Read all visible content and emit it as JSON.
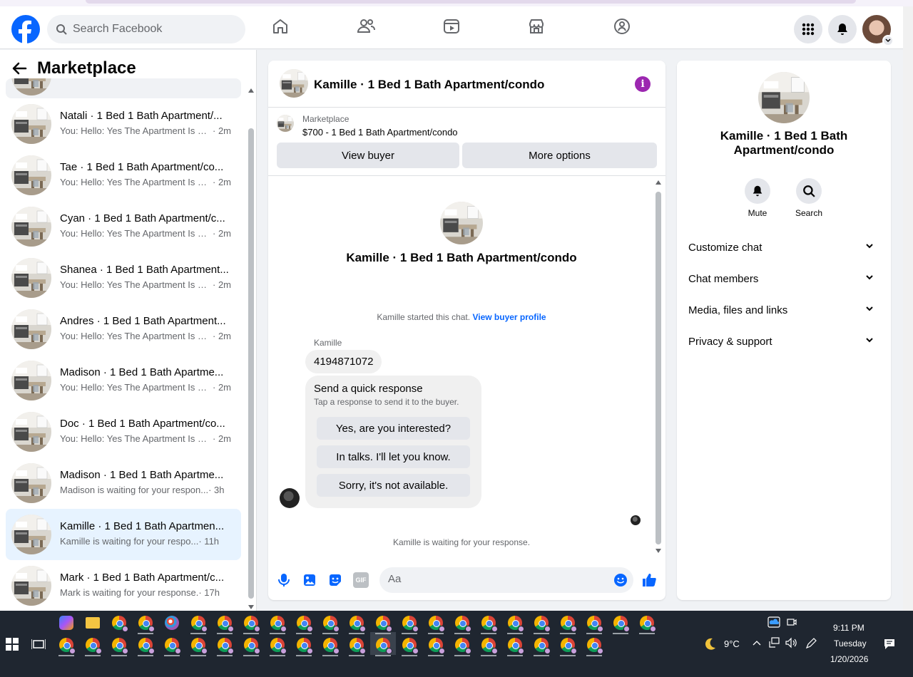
{
  "topnav": {
    "search_placeholder": "Search Facebook"
  },
  "left": {
    "back_label": "←",
    "title": "Marketplace",
    "conversations": [
      {
        "name": "Natali · 1 Bed 1 Bath Apartment/...",
        "preview": "You: Hello: Yes The Apartment Is St...",
        "time": " · 2m"
      },
      {
        "name": "Tae · 1 Bed 1 Bath Apartment/co...",
        "preview": "You: Hello: Yes The Apartment Is St...",
        "time": " · 2m"
      },
      {
        "name": "Cyan · 1 Bed 1 Bath Apartment/c...",
        "preview": "You: Hello: Yes The Apartment Is St...",
        "time": " · 2m"
      },
      {
        "name": "Shanea · 1 Bed 1 Bath Apartment...",
        "preview": "You: Hello: Yes The Apartment Is St...",
        "time": " · 2m"
      },
      {
        "name": "Andres · 1 Bed 1 Bath Apartment...",
        "preview": "You: Hello: Yes The Apartment Is St...",
        "time": " · 2m"
      },
      {
        "name": "Madison · 1 Bed 1 Bath Apartme...",
        "preview": "You: Hello: Yes The Apartment Is St...",
        "time": " · 2m"
      },
      {
        "name": "Doc · 1 Bed 1 Bath Apartment/co...",
        "preview": "You: Hello: Yes The Apartment Is St...",
        "time": " · 2m"
      },
      {
        "name": "Madison · 1 Bed 1 Bath Apartme...",
        "preview": "Madison is waiting for your respon...",
        "time": " · 3h"
      },
      {
        "name": "Kamille · 1 Bed 1 Bath Apartmen...",
        "preview": "Kamille is waiting for your respo...",
        "time": " · 11h"
      },
      {
        "name": "Mark · 1 Bed 1 Bath Apartment/c...",
        "preview": "Mark is waiting for your response.",
        "time": " · 17h"
      }
    ]
  },
  "chat": {
    "title": "Kamille · 1 Bed 1 Bath Apartment/condo",
    "marketplace_label": "Marketplace",
    "listing": "$700 - 1 Bed 1 Bath Apartment/condo",
    "view_buyer": "View buyer",
    "more_options": "More options",
    "intro_title": "Kamille · 1 Bed 1 Bath Apartment/condo",
    "started_text": "Kamille started this chat.",
    "view_buyer_profile": "View buyer profile",
    "sender": "Kamille",
    "message": "4194871072",
    "quick_title": "Send a quick response",
    "quick_sub": "Tap a response to send it to the buyer.",
    "quick_responses": [
      "Yes, are you interested?",
      "In talks. I'll let you know.",
      "Sorry, it's not available."
    ],
    "waiting": "Kamille is waiting for your response.",
    "input_placeholder": "Aa",
    "gif_label": "GIF"
  },
  "info": {
    "title": "Kamille · 1 Bed 1 Bath Apartment/condo",
    "mute": "Mute",
    "search": "Search",
    "sections": [
      "Customize chat",
      "Chat members",
      "Media, files and links",
      "Privacy & support"
    ]
  },
  "taskbar": {
    "temperature": "9°C",
    "time": "9:11 PM",
    "day": "Tuesday",
    "date": "1/20/2026"
  },
  "colors": {
    "brand_blue": "#0866ff",
    "active_row": "#e7f3ff",
    "info_purple": "#9c27b0",
    "taskbar": "#1f2630"
  }
}
